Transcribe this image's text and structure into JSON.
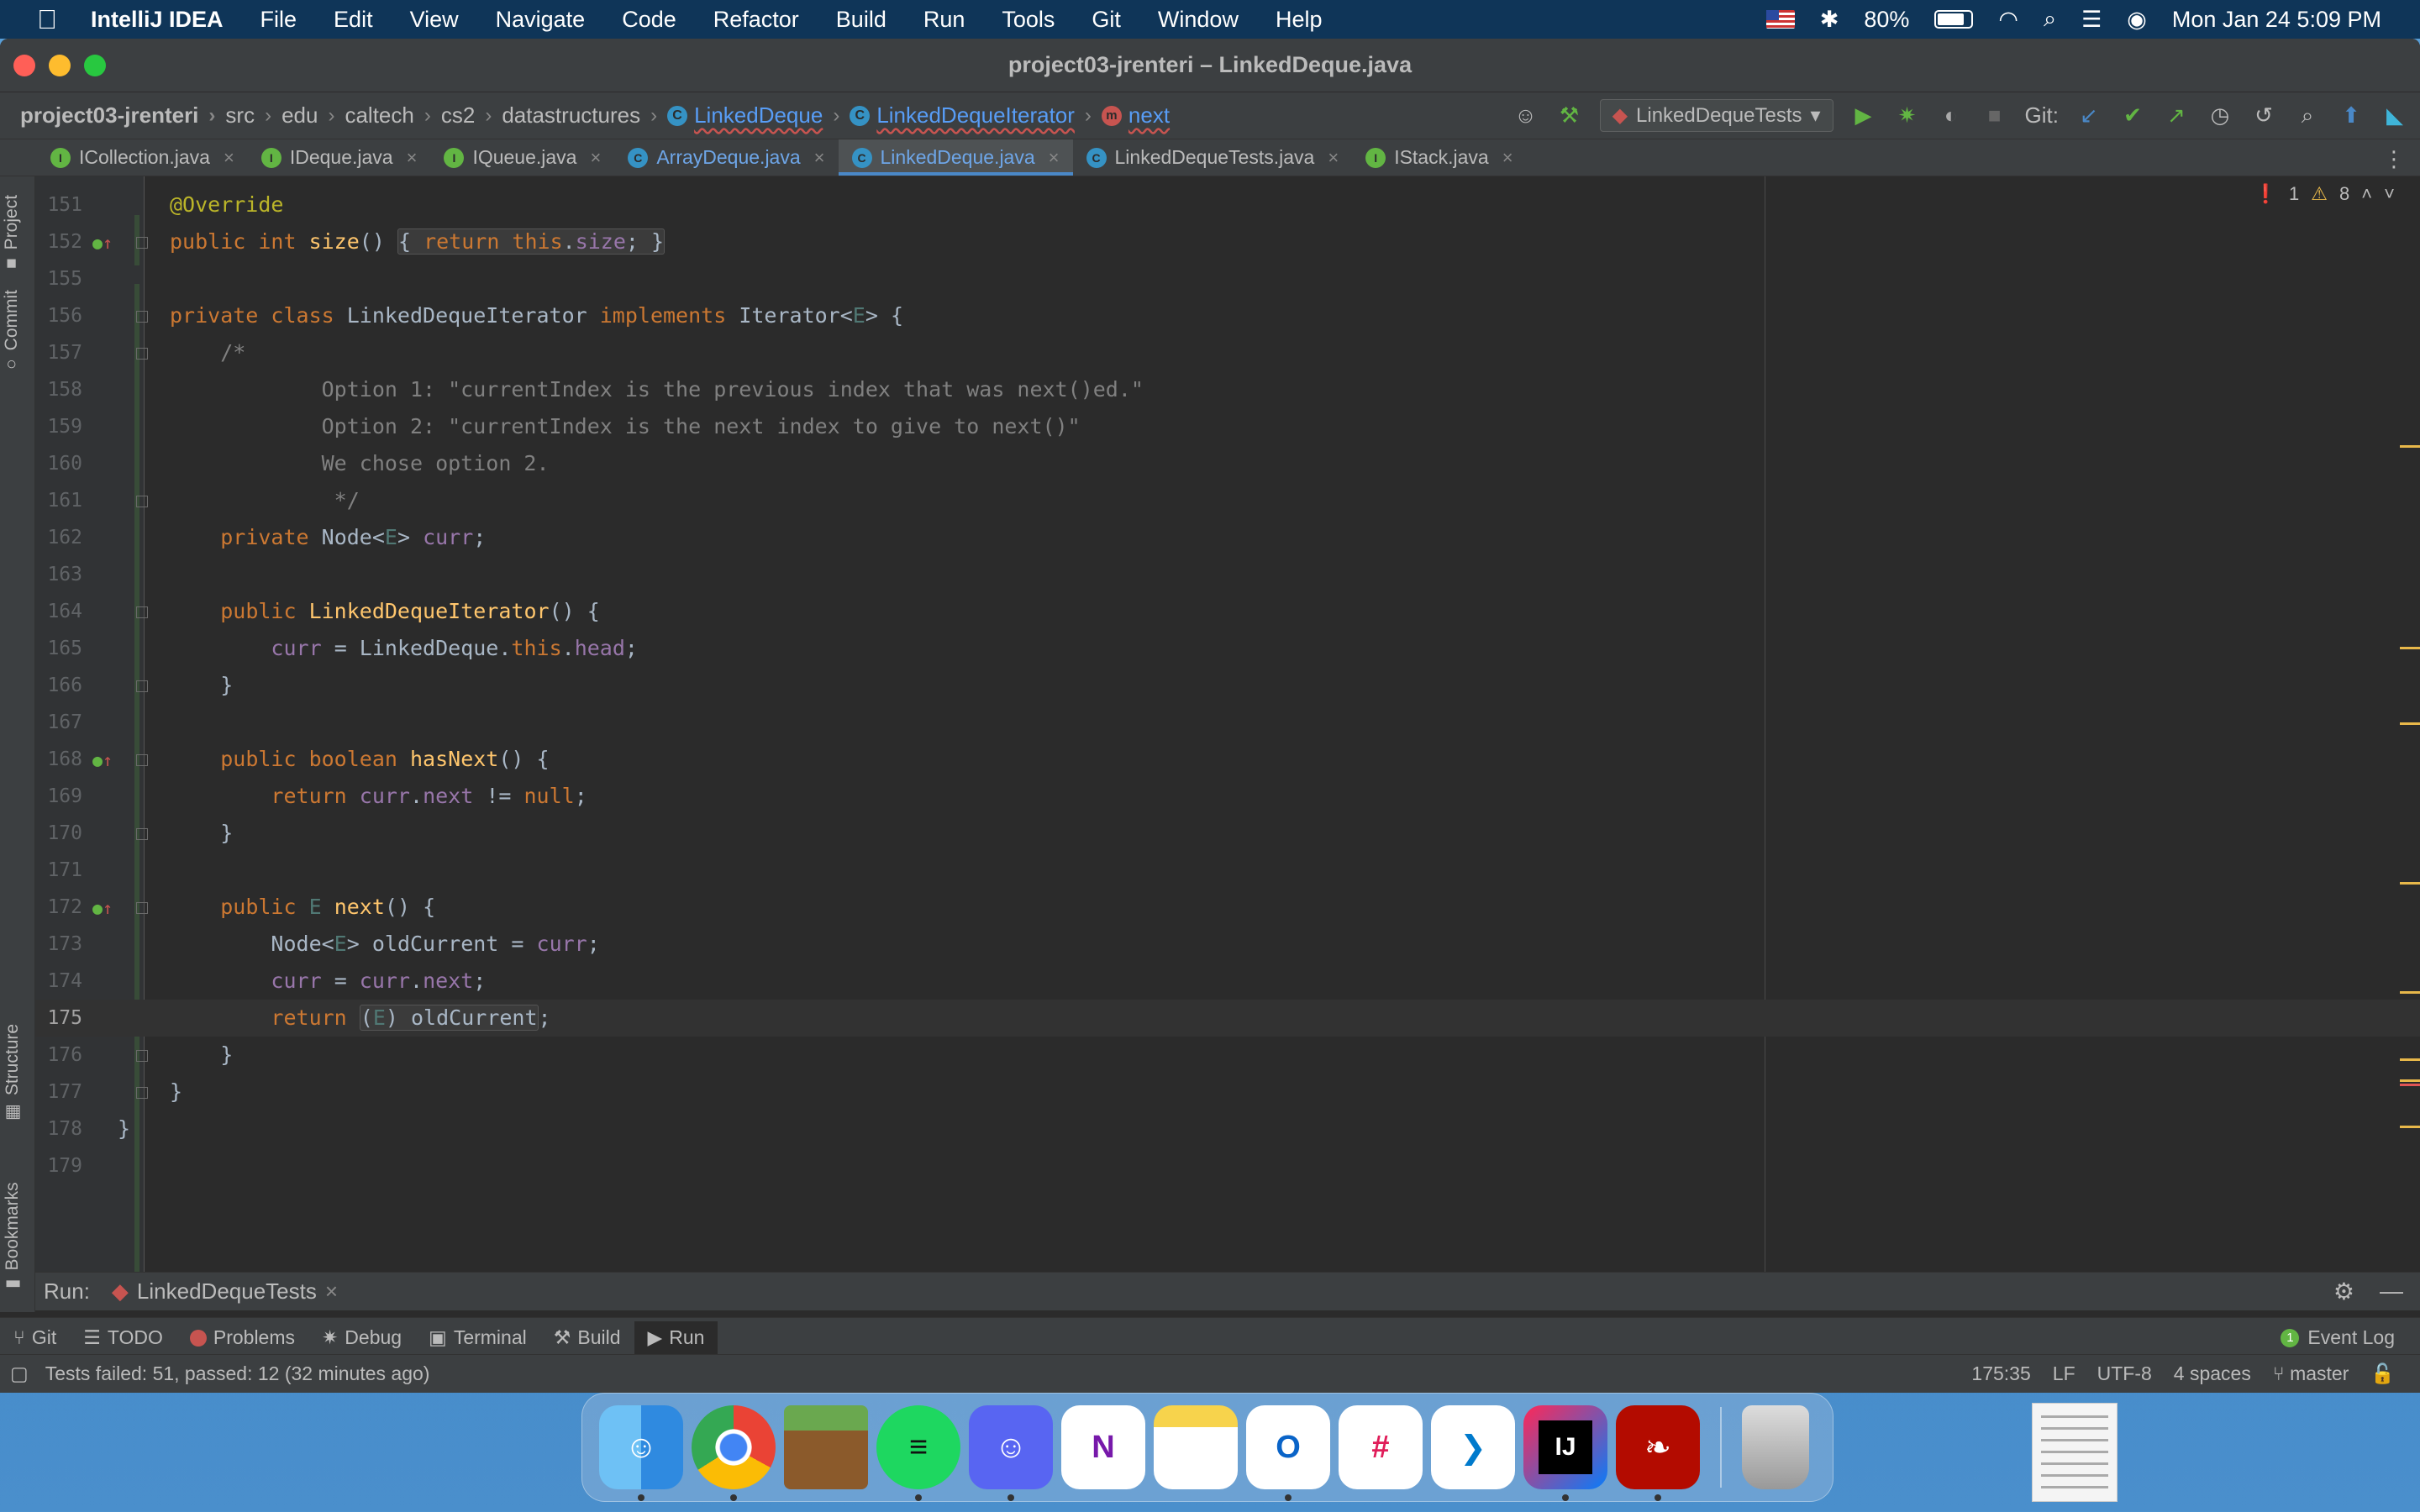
{
  "menubar": {
    "app_name": "IntelliJ IDEA",
    "menus": [
      "File",
      "Edit",
      "View",
      "Navigate",
      "Code",
      "Refactor",
      "Build",
      "Run",
      "Tools",
      "Git",
      "Window",
      "Help"
    ],
    "battery": "80%",
    "battery_level": 0.8,
    "clock": "Mon Jan 24  5:09 PM"
  },
  "window": {
    "title": "project03-jrenteri – LinkedDeque.java"
  },
  "breadcrumbs": [
    "project03-jrenteri",
    "src",
    "edu",
    "caltech",
    "cs2",
    "datastructures",
    "LinkedDeque",
    "LinkedDequeIterator",
    "next"
  ],
  "toolbar": {
    "run_config": "LinkedDequeTests",
    "git_label": "Git:"
  },
  "tabs": [
    {
      "label": "ICollection.java",
      "kind": "interface"
    },
    {
      "label": "IDeque.java",
      "kind": "interface"
    },
    {
      "label": "IQueue.java",
      "kind": "interface"
    },
    {
      "label": "ArrayDeque.java",
      "kind": "class"
    },
    {
      "label": "LinkedDeque.java",
      "kind": "class"
    },
    {
      "label": "LinkedDequeTests.java",
      "kind": "test-class"
    },
    {
      "label": "IStack.java",
      "kind": "interface"
    }
  ],
  "active_tab": "LinkedDeque.java",
  "left_strip": {
    "project": "Project",
    "commit": "Commit",
    "structure": "Structure",
    "bookmarks": "Bookmarks"
  },
  "inspections": {
    "errors": "1",
    "warnings": "8"
  },
  "editor": {
    "current_line": "175",
    "line_numbers": [
      "151",
      "152",
      "155",
      "156",
      "157",
      "158",
      "159",
      "160",
      "161",
      "162",
      "163",
      "164",
      "165",
      "166",
      "167",
      "168",
      "169",
      "170",
      "171",
      "172",
      "173",
      "174",
      "175",
      "176",
      "177",
      "178",
      "179"
    ]
  },
  "run_panel": {
    "label": "Run:",
    "tab": "LinkedDequeTests"
  },
  "tool_windows": [
    "Git",
    "TODO",
    "Problems",
    "Debug",
    "Terminal",
    "Build",
    "Run"
  ],
  "event_log": "Event Log",
  "event_log_count": "1",
  "status": {
    "message": "Tests failed: 51, passed: 12 (32 minutes ago)",
    "position": "175:35",
    "line_sep": "LF",
    "encoding": "UTF-8",
    "indent": "4 spaces",
    "branch": "master"
  },
  "dock_apps": [
    "Finder",
    "Chrome",
    "Minecraft",
    "Spotify",
    "Discord",
    "OneNote",
    "Notes",
    "Outlook",
    "Slack",
    "VS Code",
    "IntelliJ IDEA",
    "Acrobat",
    "Trash"
  ]
}
